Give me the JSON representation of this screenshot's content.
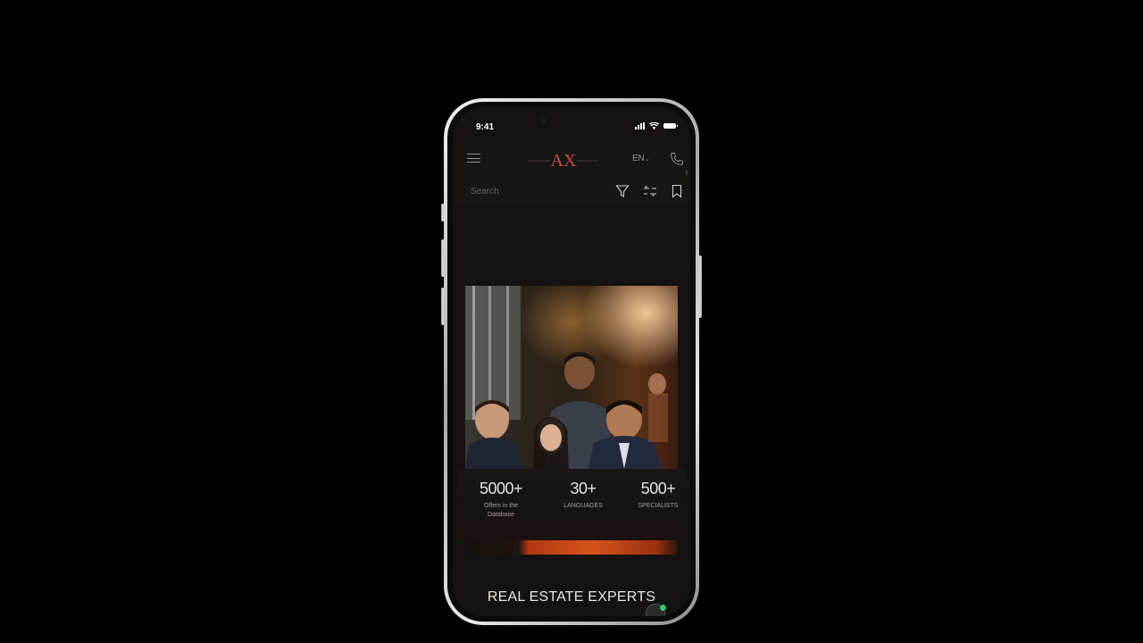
{
  "status_bar": {
    "time": "9:41"
  },
  "navbar": {
    "language": "EN",
    "logo_text": "AX"
  },
  "search": {
    "placeholder": "Search"
  },
  "stats": [
    {
      "value": "5000+",
      "label": "Offers in the Database"
    },
    {
      "value": "30+",
      "label": "LANGUAGES"
    },
    {
      "value": "500+",
      "label": "SPECIALISTS"
    }
  ],
  "section": {
    "heading": "REAL ESTATE EXPERTS"
  },
  "colors": {
    "background": "#000000",
    "app_bg": "#141212",
    "bar_bg": "#181515",
    "accent": "#c8503a",
    "muted_text": "#9a8f88",
    "chat_online": "#2ecc71"
  },
  "icons": [
    "menu-icon",
    "logo-icon",
    "chevron-down-icon",
    "phone-icon",
    "filter-icon",
    "sliders-icon",
    "bookmark-icon",
    "chat-icon"
  ]
}
